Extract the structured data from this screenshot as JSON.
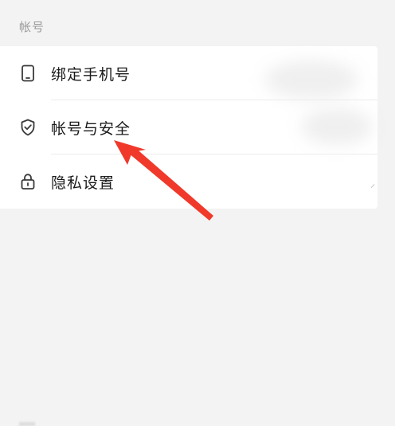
{
  "section": {
    "title": "帐号"
  },
  "items": [
    {
      "label": "绑定手机号",
      "icon": "phone-icon"
    },
    {
      "label": "帐号与安全",
      "icon": "shield-check-icon"
    },
    {
      "label": "隐私设置",
      "icon": "lock-icon"
    }
  ],
  "colors": {
    "background": "#f3f3f3",
    "card": "#ffffff",
    "text": "#1a1a1a",
    "section_title": "#9a9a9a",
    "divider": "#ececec",
    "icon": "#3a3a3a",
    "annotation_arrow": "#f0392b"
  }
}
